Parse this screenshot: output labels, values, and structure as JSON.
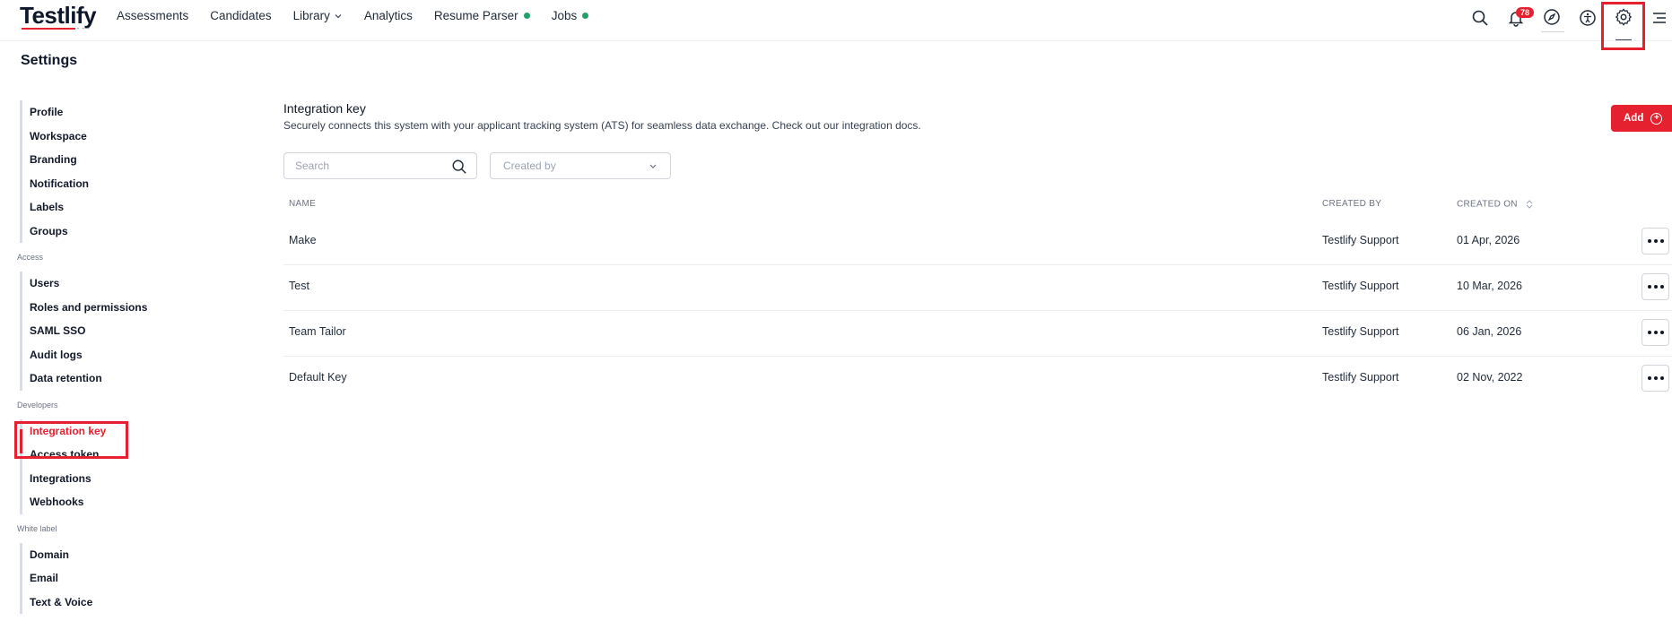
{
  "nav": {
    "logo": "Testlify",
    "logo_sub": "• • •",
    "items": [
      {
        "label": "Assessments"
      },
      {
        "label": "Candidates"
      },
      {
        "label": "Library"
      },
      {
        "label": "Analytics"
      },
      {
        "label": "Resume Parser"
      },
      {
        "label": "Jobs"
      }
    ],
    "notification_count": "78",
    "icons": [
      "search-icon",
      "bell-icon",
      "compass-icon",
      "accessibility-icon",
      "gear-icon",
      "menu-icon"
    ]
  },
  "page": {
    "title": "Settings"
  },
  "sidebar": {
    "general": [
      "Profile",
      "Workspace",
      "Branding",
      "Notification",
      "Labels",
      "Groups"
    ],
    "access_heading": "Access",
    "access": [
      "Users",
      "Roles and permissions",
      "SAML SSO",
      "Audit logs",
      "Data retention"
    ],
    "developers_heading": "Developers",
    "developers": [
      "Integration key",
      "Access token",
      "Integrations",
      "Webhooks"
    ],
    "white_label_heading": "White label",
    "white_label": [
      "Domain",
      "Email",
      "Text & Voice"
    ]
  },
  "main": {
    "title": "Integration key",
    "subtitle": "Securely connects this system with your applicant tracking system (ATS) for seamless data exchange. Check out our integration docs.",
    "add_label": "Add",
    "search_placeholder": "Search",
    "filter_placeholder": "Created by",
    "columns": {
      "name": "NAME",
      "created_by": "CREATED BY",
      "created_on": "CREATED ON"
    },
    "rows": [
      {
        "name": "Make",
        "created_by": "Testlify Support",
        "created_on": "01 Apr, 2026"
      },
      {
        "name": "Test",
        "created_by": "Testlify Support",
        "created_on": "10 Mar, 2026"
      },
      {
        "name": "Team Tailor",
        "created_by": "Testlify Support",
        "created_on": "06 Jan, 2026"
      },
      {
        "name": "Default Key",
        "created_by": "Testlify Support",
        "created_on": "02 Nov, 2022"
      }
    ]
  },
  "colors": {
    "accent": "#e5202f",
    "status_dot": "#22a06b"
  }
}
